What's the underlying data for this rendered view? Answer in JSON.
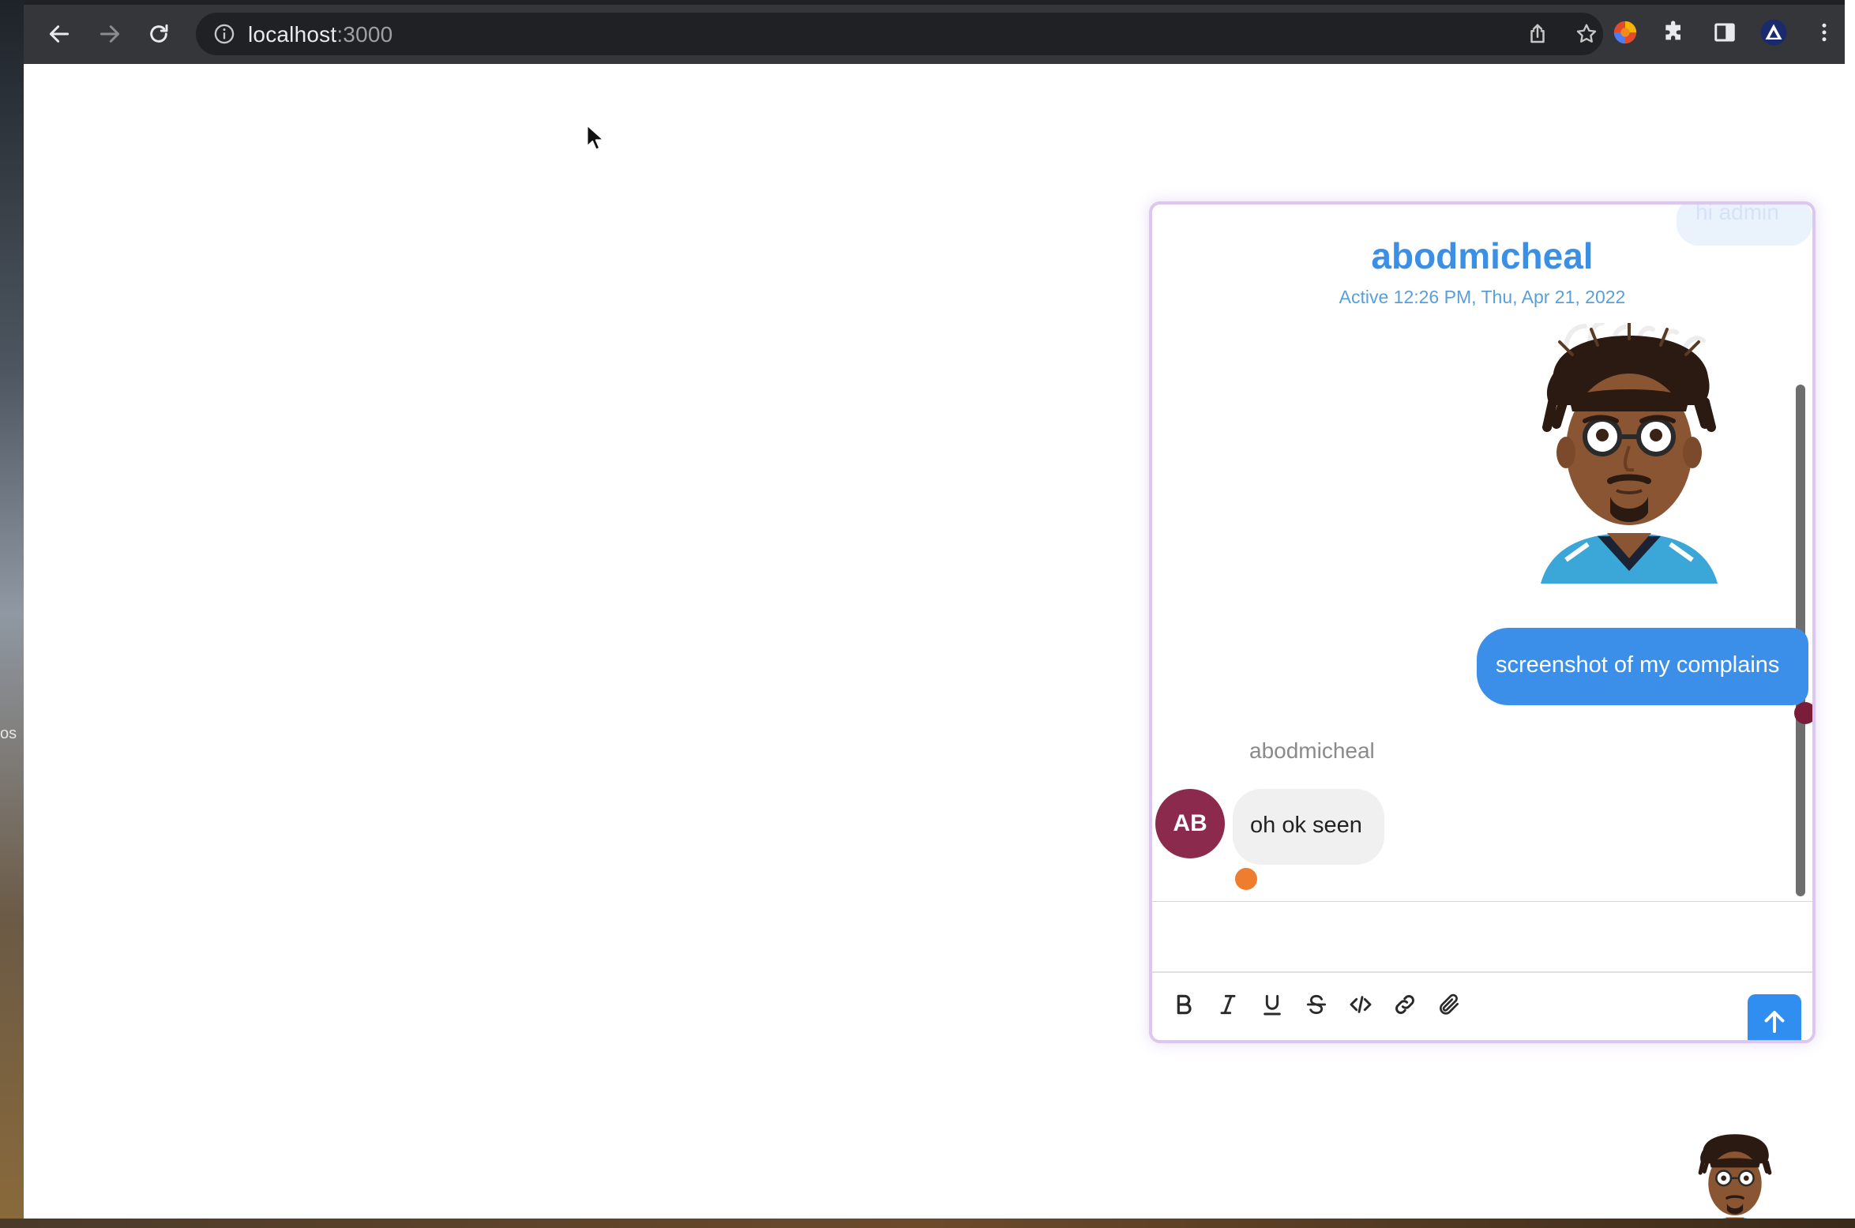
{
  "desktop": {
    "left_label": "os"
  },
  "browser": {
    "url_host": "localhost",
    "url_port": ":3000"
  },
  "chat": {
    "peek_message": "hi admin",
    "title": "abodmicheal",
    "subtitle": "Active 12:26 PM, Thu, Apr 21, 2022",
    "messages": {
      "sent": {
        "text": "screenshot of my complains"
      },
      "received": {
        "sender": "abodmicheal",
        "avatar_initials": "AB",
        "text": "oh ok seen"
      }
    },
    "composer": {
      "value": ""
    },
    "toolbar": [
      "bold-icon",
      "italic-icon",
      "underline-icon",
      "strikethrough-icon",
      "code-icon",
      "link-icon",
      "attachment-icon"
    ]
  },
  "colors": {
    "accent": "#3b8fe4",
    "sent_bubble": "#3b8fe8",
    "received_bubble": "#f0f0f0",
    "avatar": "#8c2a4e",
    "unread_dot": "#ee7d30",
    "read_dot": "#7a1d3a",
    "chat_border": "#dcc7f0"
  }
}
